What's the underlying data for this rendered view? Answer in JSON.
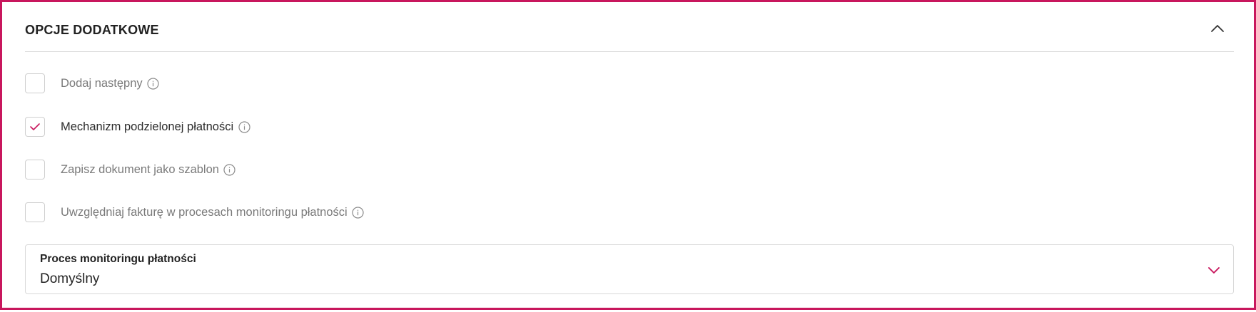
{
  "section": {
    "title": "OPCJE DODATKOWE"
  },
  "options": [
    {
      "label": "Dodaj następny",
      "checked": false
    },
    {
      "label": "Mechanizm podzielonej płatności",
      "checked": true
    },
    {
      "label": "Zapisz dokument jako szablon",
      "checked": false
    },
    {
      "label": "Uwzględniaj fakturę w procesach monitoringu płatności",
      "checked": false
    }
  ],
  "select": {
    "label": "Proces monitoringu płatności",
    "value": "Domyślny"
  },
  "colors": {
    "accent": "#c8175d",
    "text": "#222222",
    "muted": "#7a7a7a",
    "border": "#d9d9d9"
  },
  "icons": {
    "collapse": "chevron-up-icon",
    "info": "info-icon",
    "check": "checkmark-icon",
    "dropdown": "chevron-down-icon"
  }
}
